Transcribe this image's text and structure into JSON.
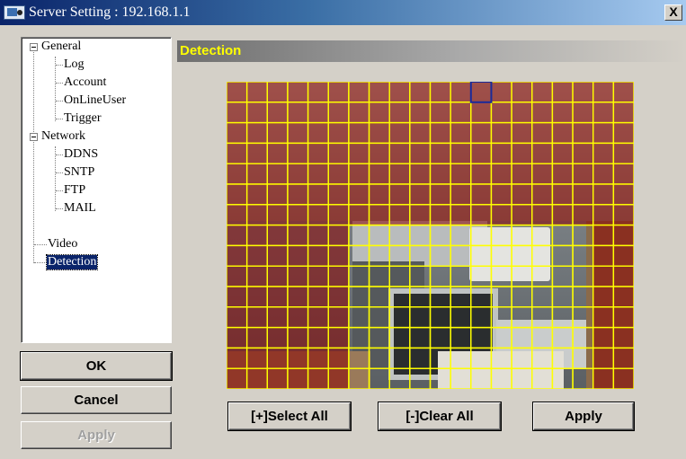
{
  "window": {
    "title": "Server Setting : 192.168.1.1",
    "close_label": "X"
  },
  "tree": {
    "items": [
      {
        "label": "General",
        "expanded": true,
        "level": 0
      },
      {
        "label": "Log",
        "level": 1
      },
      {
        "label": "Account",
        "level": 1
      },
      {
        "label": "OnLineUser",
        "level": 1
      },
      {
        "label": "Trigger",
        "level": 1
      },
      {
        "label": "Network",
        "expanded": true,
        "level": 0
      },
      {
        "label": "DDNS",
        "level": 1
      },
      {
        "label": "SNTP",
        "level": 1
      },
      {
        "label": "FTP",
        "level": 1
      },
      {
        "label": "MAIL",
        "level": 1
      },
      {
        "label": "Video",
        "level": 0
      },
      {
        "label": "Detection",
        "level": 0,
        "selected": true
      }
    ]
  },
  "buttons": {
    "ok": "OK",
    "cancel": "Cancel",
    "apply_left": "Apply",
    "select_all": "[+]Select All",
    "clear_all": "[-]Clear All",
    "apply_right": "Apply"
  },
  "section": {
    "title": "Detection"
  },
  "detection_grid": {
    "rows": 15,
    "cols": 20,
    "selected_color": "#8b0000",
    "grid_line_color": "#ffff00",
    "cursor_color": "#1a2a9a",
    "cursor_cell": [
      0,
      12
    ],
    "unselected_region": {
      "row_start": 7,
      "col_start": 6,
      "col_end_exclusive": 18
    }
  }
}
